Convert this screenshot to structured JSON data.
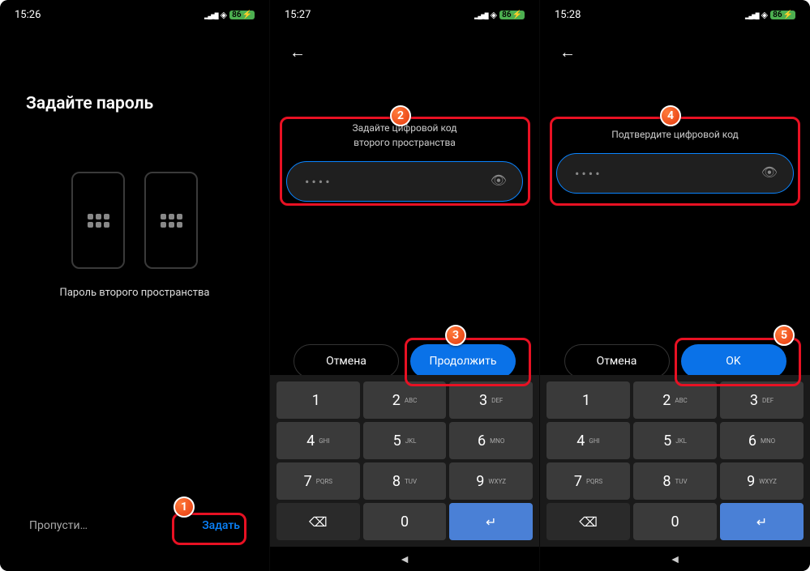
{
  "s1": {
    "time": "15:26",
    "batt": "86",
    "title": "Задайте пароль",
    "caption": "Пароль второго пространства",
    "skip": "Пропусти…",
    "set": "Задать"
  },
  "s2": {
    "time": "15:27",
    "batt": "86",
    "prompt1": "Задайте цифровой код",
    "prompt2": "второго пространства",
    "pin": "••••",
    "cancel": "Отмена",
    "cont": "Продолжить"
  },
  "s3": {
    "time": "15:28",
    "batt": "86",
    "prompt": "Подтвердите цифровой код",
    "pin": "••••",
    "cancel": "Отмена",
    "ok": "OK"
  },
  "keys": [
    [
      {
        "n": "1",
        "l": ""
      },
      {
        "n": "2",
        "l": "ABC"
      },
      {
        "n": "3",
        "l": "DEF"
      }
    ],
    [
      {
        "n": "4",
        "l": "GHI"
      },
      {
        "n": "5",
        "l": "JKL"
      },
      {
        "n": "6",
        "l": "MNO"
      }
    ],
    [
      {
        "n": "7",
        "l": "PQRS"
      },
      {
        "n": "8",
        "l": "TUV"
      },
      {
        "n": "9",
        "l": "WXYZ"
      }
    ]
  ],
  "markers": {
    "m1": "1",
    "m2": "2",
    "m3": "3",
    "m4": "4",
    "m5": "5"
  }
}
